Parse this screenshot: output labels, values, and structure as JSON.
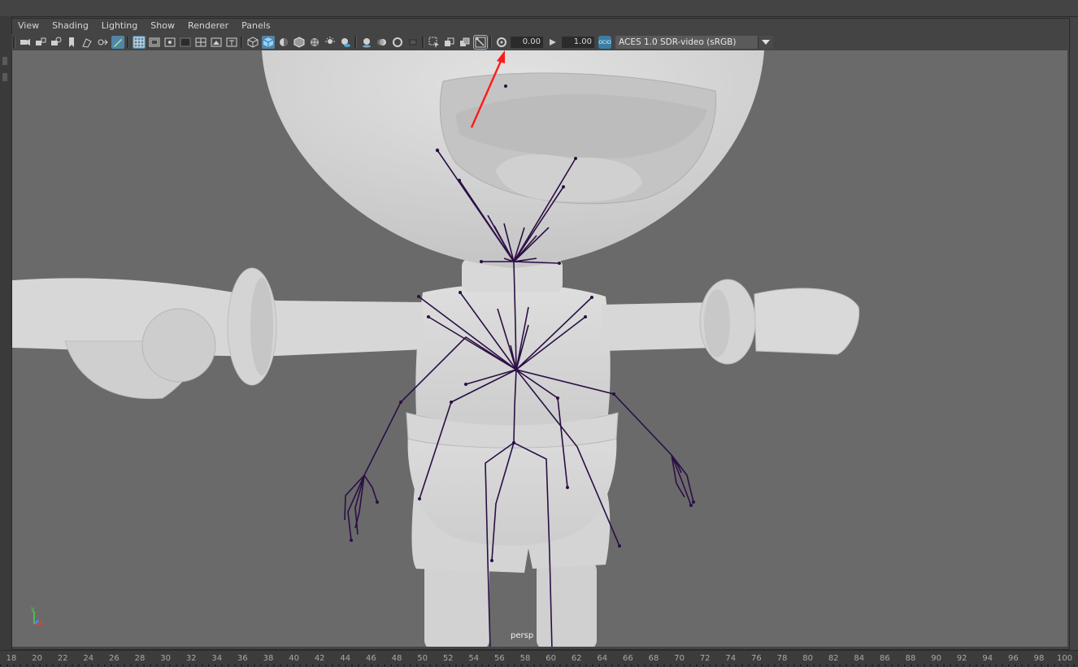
{
  "menu": [
    "View",
    "Shading",
    "Lighting",
    "Show",
    "Renderer",
    "Panels"
  ],
  "toolbar": {
    "exposure_value": "0.00",
    "gamma_value": "1.00",
    "color_space_icon_text": "OCIO",
    "color_space": "ACES 1.0 SDR-video (sRGB)"
  },
  "viewport": {
    "camera_label": "persp",
    "background_color": "#6a6a6a",
    "mesh_color": "#d9d9d9",
    "skeleton_color": "#2b0f45",
    "annotation_arrow_color": "#ff1a1a"
  },
  "axis": {
    "x": "x",
    "y": "y",
    "z": "z"
  },
  "timeline": {
    "numbers": [
      "18",
      "20",
      "22",
      "24",
      "26",
      "28",
      "30",
      "32",
      "34",
      "36",
      "38",
      "40",
      "42",
      "44",
      "46",
      "48",
      "50",
      "52",
      "54",
      "56",
      "58",
      "60",
      "62",
      "64",
      "66",
      "68",
      "70",
      "72",
      "74",
      "76",
      "78",
      "80",
      "82",
      "84",
      "86",
      "88",
      "90",
      "92",
      "94",
      "96",
      "98",
      "100"
    ]
  }
}
